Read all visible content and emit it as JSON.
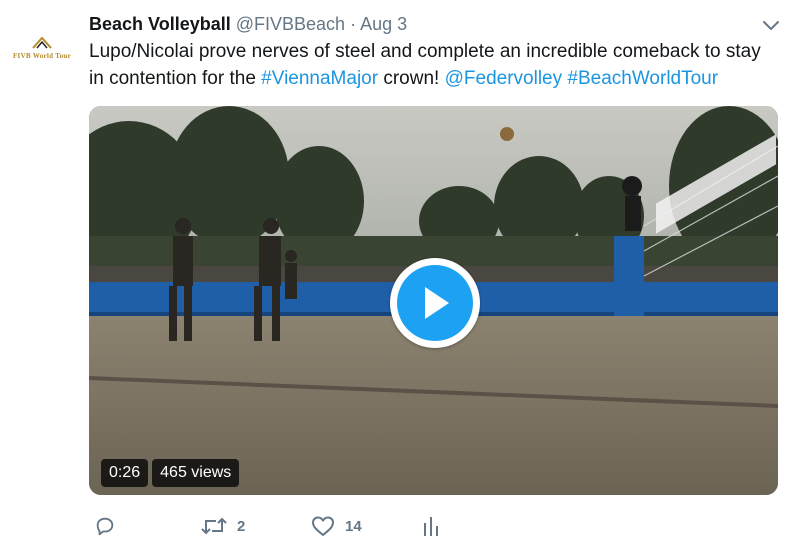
{
  "account": {
    "name": "Beach Volleyball",
    "handle": "@FIVBBeach",
    "separator": "·",
    "date": "Aug 3",
    "avatar_logo": "FIVB World Tour"
  },
  "tweet": {
    "text_parts": [
      {
        "type": "text",
        "value": "Lupo/Nicolai prove nerves of steel and complete an incredible comeback to stay in contention for the "
      },
      {
        "type": "link",
        "value": "#ViennaMajor"
      },
      {
        "type": "text",
        "value": " crown! "
      },
      {
        "type": "link",
        "value": "@Federvolley"
      },
      {
        "type": "text",
        "value": " "
      },
      {
        "type": "link",
        "value": "#BeachWorldTour"
      }
    ]
  },
  "video": {
    "duration": "0:26",
    "views": "465 views",
    "play_icon": "play-icon"
  },
  "actions": {
    "reply_icon": "reply-icon",
    "retweet_icon": "retweet-icon",
    "retweet_count": "2",
    "like_icon": "heart-icon",
    "like_count": "14",
    "analytics_icon": "analytics-icon"
  },
  "colors": {
    "link": "#1b95e0",
    "play_button": "#1da1f2",
    "muted": "#657786"
  }
}
